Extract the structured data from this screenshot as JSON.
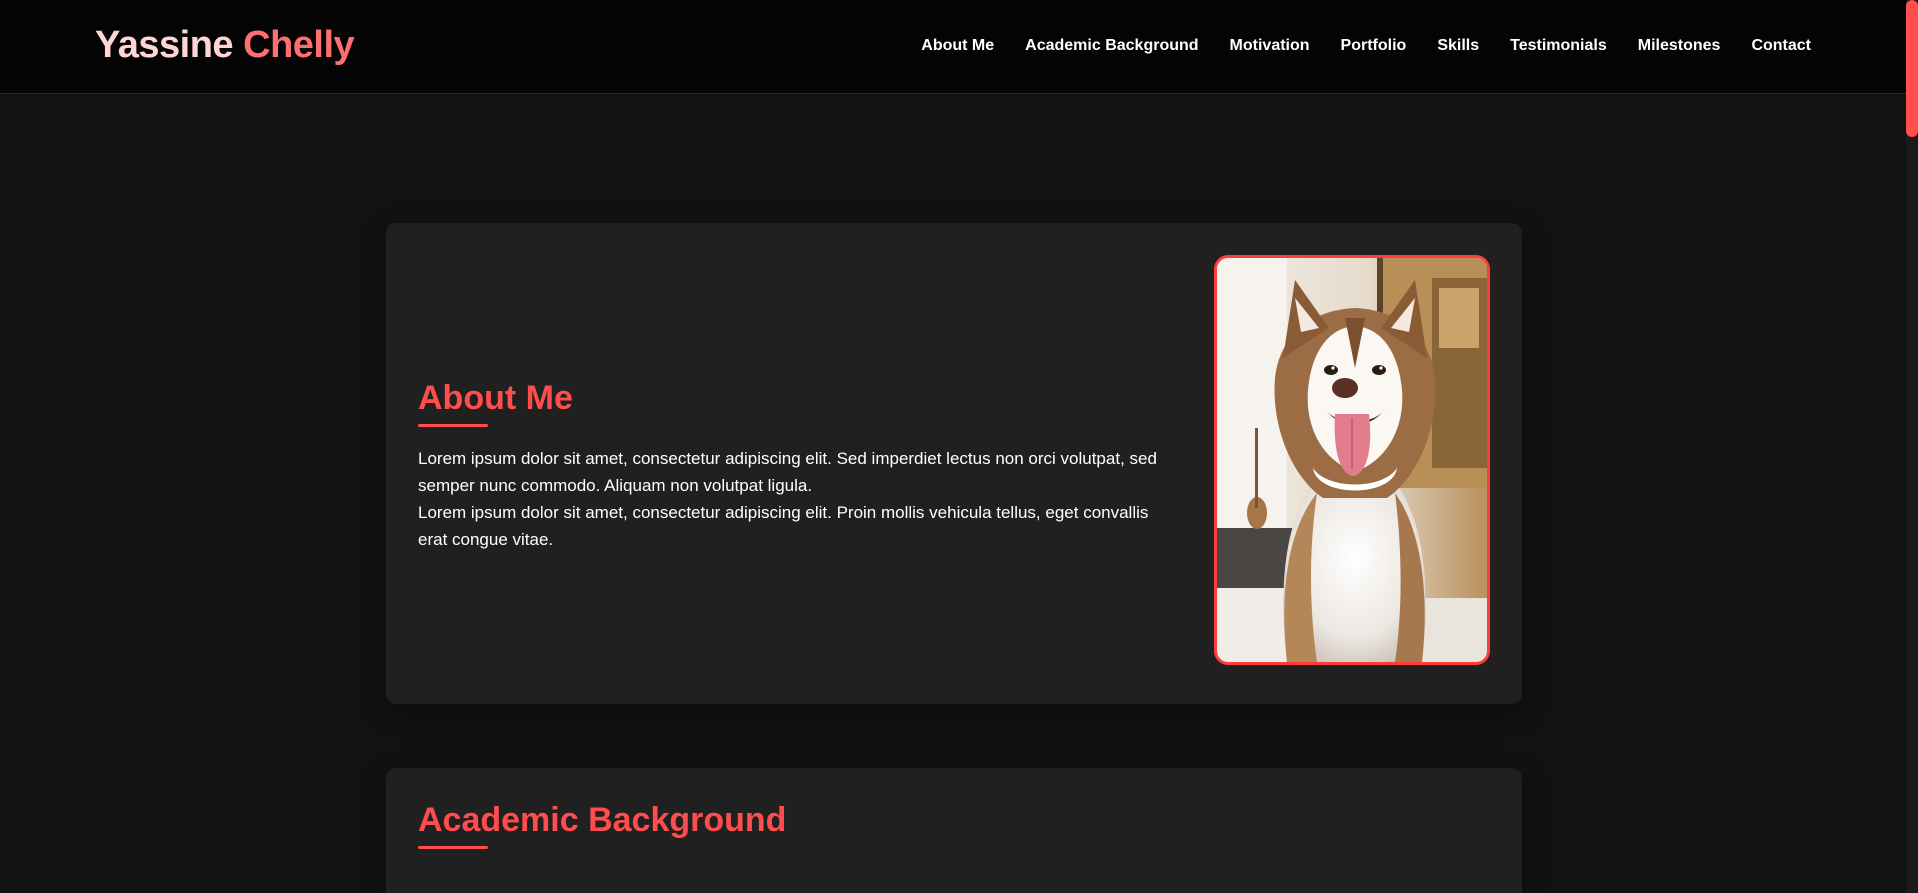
{
  "header": {
    "brand_first": "Yassine",
    "brand_last": "Chelly",
    "nav": [
      "About Me",
      "Academic Background",
      "Motivation",
      "Portfolio",
      "Skills",
      "Testimonials",
      "Milestones",
      "Contact"
    ]
  },
  "about": {
    "title": "About Me",
    "paragraphs": [
      "Lorem ipsum dolor sit amet, consectetur adipiscing elit. Sed imperdiet lectus non orci volutpat, sed semper nunc commodo. Aliquam non volutpat ligula.",
      "Lorem ipsum dolor sit amet, consectetur adipiscing elit. Proin mollis vehicula tellus, eget convallis erat congue vitae."
    ],
    "photo_subject": "husky-dog"
  },
  "academic": {
    "title": "Academic Background"
  },
  "colors": {
    "accent": "#ff4d4d",
    "brand_first": "#ffd5d5",
    "brand_last": "#ff6f6f",
    "background": "#121212",
    "card": "#202020",
    "nav_bg": "#040404"
  }
}
